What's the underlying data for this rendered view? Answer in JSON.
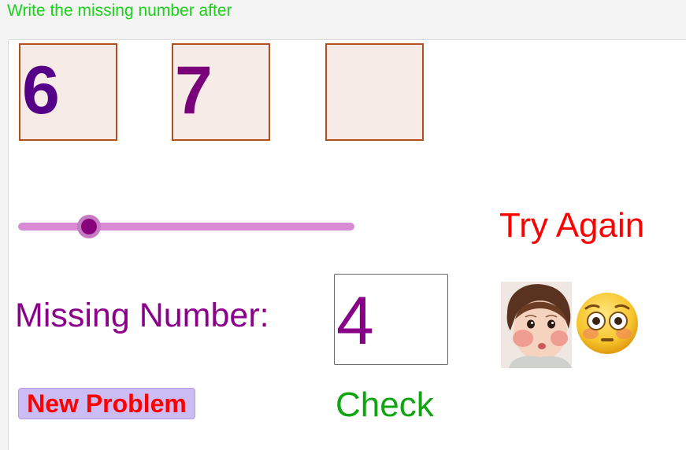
{
  "instruction": "Write the missing number after",
  "sequence": {
    "first": "6",
    "second": "7",
    "third": ""
  },
  "slider": {
    "value_fraction": 0.21
  },
  "feedback": "Try Again",
  "missing": {
    "label": "Missing Number:",
    "value": "4"
  },
  "buttons": {
    "new_problem": "New Problem",
    "check": "Check"
  },
  "colors": {
    "title": "#19d119",
    "feedback": "#ff0000",
    "label": "#8b008b",
    "check": "#11a511"
  },
  "icons": {
    "reaction": "surprised-baby-photo",
    "emoji": "flushed-face-emoji"
  }
}
